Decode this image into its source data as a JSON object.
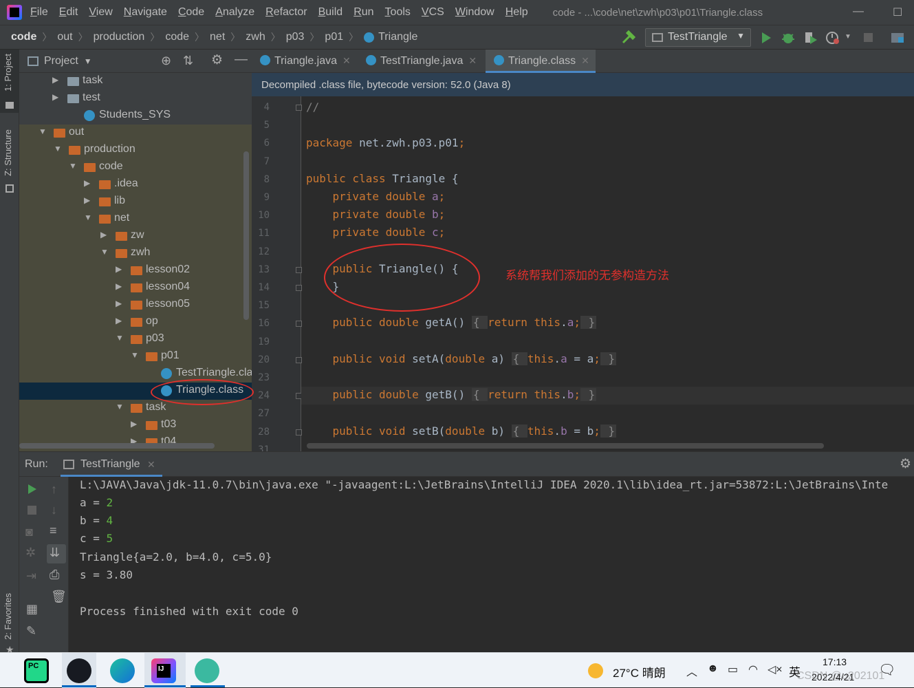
{
  "menubar": {
    "items": [
      "File",
      "Edit",
      "View",
      "Navigate",
      "Code",
      "Analyze",
      "Refactor",
      "Build",
      "Run",
      "Tools",
      "VCS",
      "Window",
      "Help"
    ],
    "window_title": "code - ...\\code\\net\\zwh\\p03\\p01\\Triangle.class",
    "min": "—",
    "max": "☐"
  },
  "navbar": {
    "crumbs": [
      "code",
      "out",
      "production",
      "code",
      "net",
      "zwh",
      "p03",
      "p01",
      "Triangle"
    ],
    "run_config": "TestTriangle"
  },
  "tool_windows": {
    "project": "1: Project",
    "structure": "Z: Structure",
    "favorites": "2: Favorites"
  },
  "project": {
    "title": "Project",
    "tree": [
      {
        "label": "task",
        "arrow": "▶",
        "type": "folder-gray"
      },
      {
        "label": "test",
        "arrow": "▶",
        "type": "folder-gray"
      },
      {
        "label": "Students_SYS",
        "arrow": "",
        "type": "class"
      },
      {
        "label": "out",
        "arrow": "▼",
        "type": "folder"
      },
      {
        "label": "production",
        "arrow": "▼",
        "type": "folder"
      },
      {
        "label": "code",
        "arrow": "▼",
        "type": "folder"
      },
      {
        "label": ".idea",
        "arrow": "▶",
        "type": "folder"
      },
      {
        "label": "lib",
        "arrow": "▶",
        "type": "folder"
      },
      {
        "label": "net",
        "arrow": "▼",
        "type": "folder"
      },
      {
        "label": "zw",
        "arrow": "▶",
        "type": "folder"
      },
      {
        "label": "zwh",
        "arrow": "▼",
        "type": "folder"
      },
      {
        "label": "lesson02",
        "arrow": "▶",
        "type": "folder"
      },
      {
        "label": "lesson04",
        "arrow": "▶",
        "type": "folder"
      },
      {
        "label": "lesson05",
        "arrow": "▶",
        "type": "folder"
      },
      {
        "label": "op",
        "arrow": "▶",
        "type": "folder"
      },
      {
        "label": "p03",
        "arrow": "▼",
        "type": "folder"
      },
      {
        "label": "p01",
        "arrow": "▼",
        "type": "folder"
      },
      {
        "label": "TestTriangle.class",
        "arrow": "",
        "type": "class"
      },
      {
        "label": "Triangle.class",
        "arrow": "",
        "type": "class"
      },
      {
        "label": "task",
        "arrow": "▼",
        "type": "folder"
      },
      {
        "label": "t03",
        "arrow": "▶",
        "type": "folder"
      },
      {
        "label": "t04",
        "arrow": "▶",
        "type": "folder"
      }
    ]
  },
  "editor": {
    "tabs": [
      "Triangle.java",
      "TestTriangle.java",
      "Triangle.class"
    ],
    "active_tab": 2,
    "banner": "Decompiled .class file, bytecode version: 52.0 (Java 8)",
    "line_numbers": [
      "4",
      "5",
      "6",
      "7",
      "8",
      "9",
      "10",
      "11",
      "12",
      "13",
      "14",
      "15",
      "16",
      "19",
      "20",
      "23",
      "24",
      "27",
      "28",
      "31"
    ],
    "annotation": "系统帮我们添加的无参构造方法"
  },
  "run": {
    "label": "Run:",
    "tab": "TestTriangle",
    "lines": [
      "L:\\JAVA\\Java\\jdk-11.0.7\\bin\\java.exe \"-javaagent:L:\\JetBrains\\IntelliJ IDEA 2020.1\\lib\\idea_rt.jar=53872:L:\\JetBrains\\Inte",
      "Triangle{a=2.0, b=4.0, c=5.0}",
      "s = 3.80",
      "Process finished with exit code 0"
    ],
    "vars": [
      {
        "name": "a",
        "value": "2"
      },
      {
        "name": "b",
        "value": "4"
      },
      {
        "name": "c",
        "value": "5"
      }
    ]
  },
  "taskbar": {
    "weather": "27°C 晴朗",
    "ime": "英",
    "time": "17:13",
    "date": "2022/4/21",
    "watermark": "CSDN @u202101"
  }
}
